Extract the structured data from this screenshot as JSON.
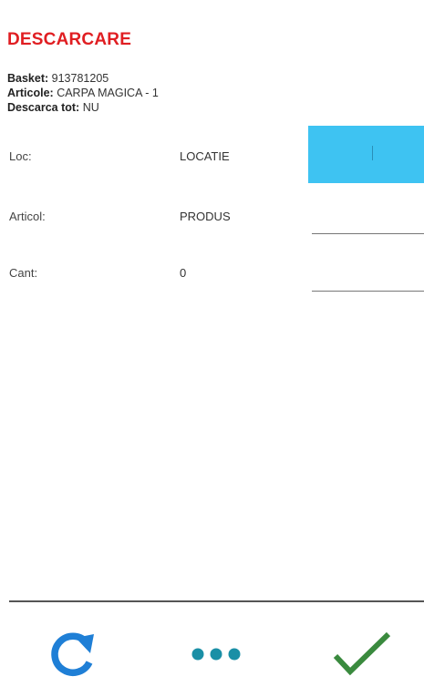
{
  "header": {
    "title": "DESCARCARE"
  },
  "info": {
    "basket_label": "Basket:",
    "basket_value": "913781205",
    "articole_label": "Articole:",
    "articole_value": "CARPA MAGICA - 1",
    "descarca_label": "Descarca tot:",
    "descarca_value": "NU"
  },
  "form": {
    "loc": {
      "label": "Loc:",
      "value": "LOCATIE",
      "input_value": ""
    },
    "articol": {
      "label": "Articol:",
      "value": "PRODUS",
      "input_value": ""
    },
    "cant": {
      "label": "Cant:",
      "value": "0",
      "input_value": ""
    }
  },
  "bottom_bar": {
    "refresh_icon": "refresh-icon",
    "more_icon": "more-horizontal-icon",
    "confirm_icon": "check-icon"
  },
  "colors": {
    "title": "#e01e22",
    "focused_input": "#3ec3f2",
    "refresh_icon": "#1f7fd6",
    "more_icon": "#1a8fa6",
    "confirm_icon": "#3a8a3e"
  }
}
